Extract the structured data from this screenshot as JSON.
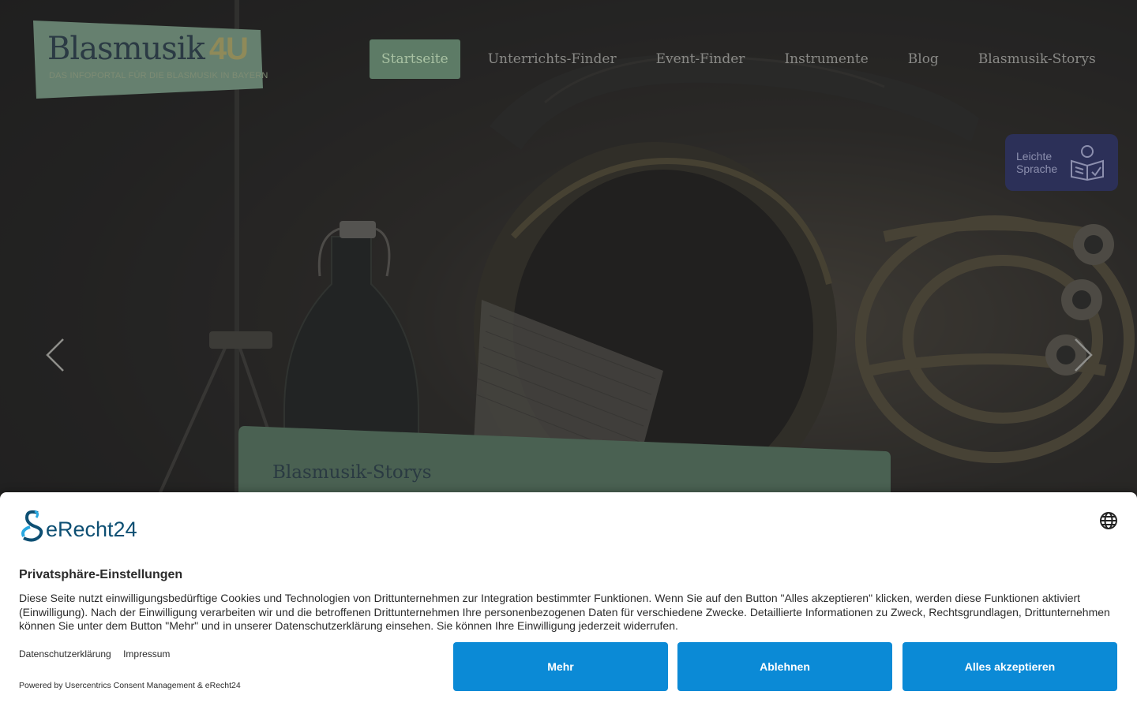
{
  "logo": {
    "name_main": "Blasmusik",
    "name_accent": "4U",
    "tagline": "DAS INFOPORTAL FÜR DIE BLASMUSIK IN BAYERN"
  },
  "nav": {
    "items": [
      {
        "label": "Startseite",
        "active": true
      },
      {
        "label": "Unterrichts-Finder"
      },
      {
        "label": "Event-Finder"
      },
      {
        "label": "Instrumente"
      },
      {
        "label": "Blog"
      },
      {
        "label": "Blasmusik-Storys"
      }
    ]
  },
  "easy_language": {
    "line1": "Leichte",
    "line2": "Sprache",
    "icon": "reading-person-icon"
  },
  "slider": {
    "prev_icon": "chevron-left-icon",
    "next_icon": "chevron-right-icon",
    "caption_title": "Blasmusik-Storys"
  },
  "consent": {
    "brand": "eRecht24",
    "language_icon": "globe-icon",
    "title": "Privatsphäre-Einstellungen",
    "body": "Diese Seite nutzt einwilligungsbedürftige Cookies und Technologien von Drittunternehmen zur Integration bestimmter Funktionen. Wenn Sie auf den Button \"Alles akzeptieren\" klicken, werden diese Funktionen aktiviert (Einwilligung). Nach der Einwilligung verarbeiten wir und die betroffenen Drittunternehmen Ihre personenbezogenen Daten für verschiedene Zwecke. Detaillierte Informationen zu Zweck, Rechtsgrundlagen, Drittunternehmen können Sie unter dem Button \"Mehr\" und in unserer Datenschutzerklärung einsehen. Sie können Ihre Einwilligung jederzeit widerrufen.",
    "link_privacy": "Datenschutzerklärung",
    "link_imprint": "Impressum",
    "powered_by": "Powered by Usercentrics Consent Management & eRecht24",
    "btn_more": "Mehr",
    "btn_deny": "Ablehnen",
    "btn_accept": "Alles akzeptieren"
  },
  "colors": {
    "nav_active_bg": "#5d7b66",
    "logo_bg": "#66806f",
    "easy_language_bg": "#2c3058",
    "caption_bg": "#4a6152",
    "consent_button": "#0b8ad6",
    "brand_teal": "#0d4f73"
  }
}
